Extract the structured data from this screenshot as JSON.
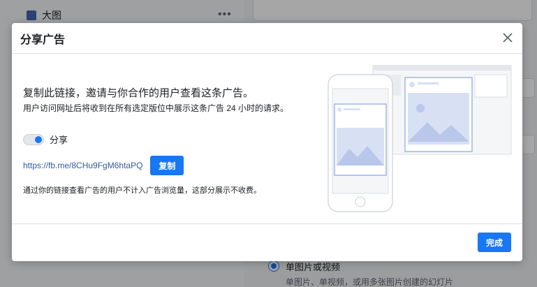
{
  "background": {
    "sidebar_item_label": "大图",
    "more_glyph": "•••",
    "option_title": "单图片或视频",
    "option_subtitle": "单图片、单视频，或用多张图片创建的幻灯片"
  },
  "modal": {
    "title": "分享广告",
    "heading": "复制此链接，邀请与你合作的用户查看这条广告。",
    "description": "用户访问网址后将收到在所有选定版位中展示这条广告 24 小时的请求。",
    "toggle_label": "分享",
    "toggle_on": true,
    "share_link": "https://fb.me/8CHu9FgM6htaPQ",
    "copy_label": "复制",
    "note": "通过你的链接查看广告的用户不计入广告浏览量，这部分展示不收费。",
    "done_label": "完成"
  },
  "colors": {
    "accent": "#1877f2",
    "link": "#385898",
    "illustration_frame": "#8aa4e6",
    "illustration_fill": "#d8e1f4"
  },
  "icons": {
    "close": "close-icon",
    "toggle": "toggle-switch-icon"
  }
}
